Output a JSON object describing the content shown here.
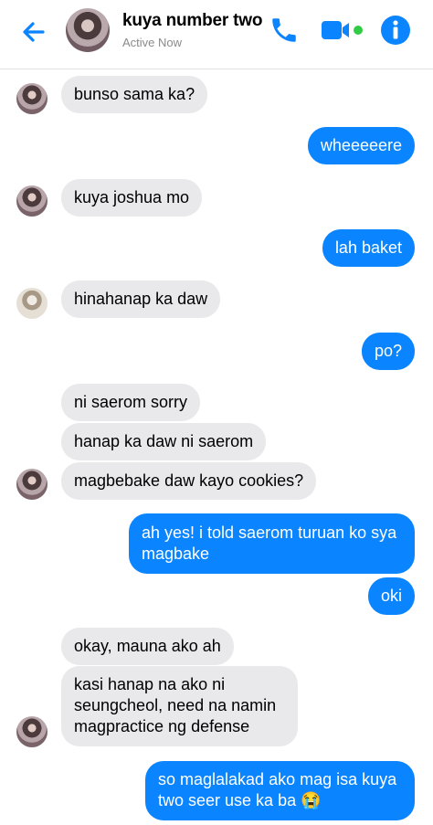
{
  "header": {
    "contact_name": "kuya number two",
    "status": "Active Now"
  },
  "colors": {
    "accent": "#0a84ff",
    "incoming_bubble": "#e9e9eb",
    "online_dot": "#31cc46"
  },
  "icons": [
    "back-arrow-icon",
    "phone-icon",
    "video-camera-icon",
    "info-icon"
  ],
  "messages": [
    {
      "from": "contact",
      "text": "bunso sama ka?"
    },
    {
      "from": "me",
      "text": "wheeeeere"
    },
    {
      "from": "contact",
      "text": "kuya joshua mo"
    },
    {
      "from": "me",
      "text": "lah baket"
    },
    {
      "from": "contact",
      "text": "hinahanap ka daw"
    },
    {
      "from": "me",
      "text": "po?"
    },
    {
      "from": "contact",
      "text": "ni saerom sorry"
    },
    {
      "from": "contact",
      "text": "hanap ka daw ni saerom"
    },
    {
      "from": "contact",
      "text": "magbebake daw kayo cookies?"
    },
    {
      "from": "me",
      "text": "ah yes! i told saerom turuan ko sya magbake"
    },
    {
      "from": "me",
      "text": "oki"
    },
    {
      "from": "contact",
      "text": "okay, mauna ako ah"
    },
    {
      "from": "contact",
      "text": "kasi hanap na ako ni seungcheol, need na namin magpractice ng defense"
    },
    {
      "from": "me",
      "text": "so maglalakad ako mag isa kuya two seer use ka ba 😭"
    }
  ]
}
